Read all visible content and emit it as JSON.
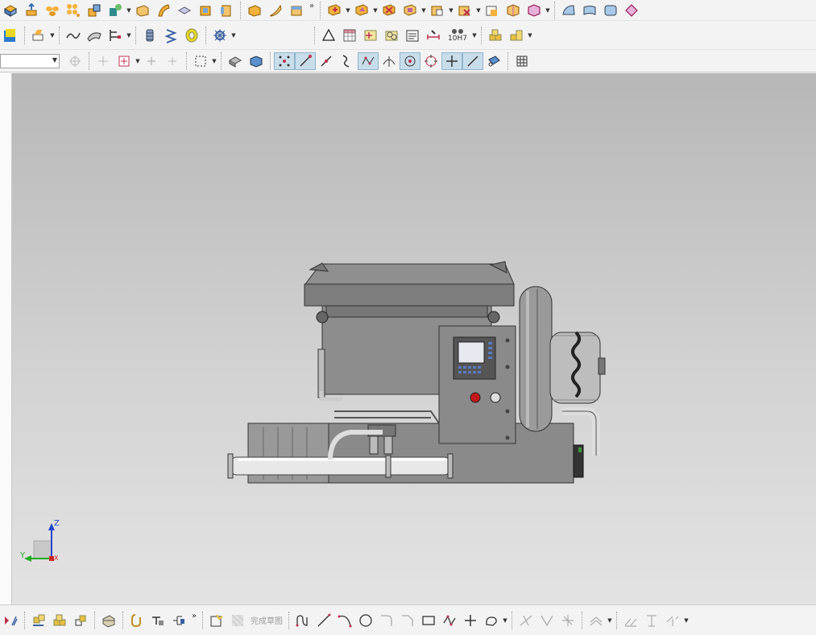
{
  "toolbar_row1": {
    "icons": [
      "block-icon",
      "extrude-icon",
      "pattern-icon",
      "pattern-array-icon",
      "boolean-unite-icon",
      "shape-icon",
      "box-icon",
      "sweep-icon",
      "thicken-icon",
      "shell-icon",
      "cylinder-icon",
      "solid-icon",
      "sheet-icon",
      "block2-icon",
      "unite-icon",
      "subtract-icon",
      "intersect-icon",
      "offset-face-icon",
      "replace-face-icon",
      "delete-face-icon",
      "move-face-icon",
      "surface-icon",
      "surface-grid-icon",
      "surface-patch-icon",
      "trim-icon"
    ],
    "overflow_label": "»"
  },
  "toolbar_row2": {
    "icons": [
      "color-face-icon",
      "text-label-icon",
      "curve-icon",
      "ribbon-icon",
      "section-icon",
      "spring-icon",
      "helix-icon",
      "washer-icon",
      "gear-icon",
      "triangle-icon",
      "table-icon",
      "grid-point-icon",
      "view-icon",
      "note-icon",
      "dimension-icon",
      "fit-label-icon",
      "assembly-icon",
      "component-icon"
    ],
    "fit_label": "10H7"
  },
  "toolbar_row3": {
    "selection_filter_value": "",
    "icons": [
      "filter-icon",
      "snap-icon",
      "select-icon",
      "plus-select-icon",
      "rect-select-icon",
      "view-shaded-icon",
      "view-solid-icon",
      "snap-points-icon",
      "snap-end-icon",
      "snap-mid-icon",
      "snap-curve-icon",
      "snap-control-icon",
      "snap-intersect-icon",
      "snap-center-icon",
      "snap-quadrant-icon",
      "snap-on-icon",
      "snap-line-icon",
      "snap-face-icon",
      "grid-icon"
    ]
  },
  "triad": {
    "z_label": "Z",
    "y_label": "Y",
    "x_label": "X"
  },
  "bottom_toolbar": {
    "finish_sketch_label": "完成草图",
    "icons": [
      "constraint-icon",
      "dimension-icon",
      "assembly-icon",
      "component-icon",
      "part-icon",
      "attach-icon",
      "tool-icon",
      "arrange-icon",
      "sketch-icon",
      "finish-sketch-icon",
      "profile-icon",
      "line-icon",
      "arc-icon",
      "circle-icon",
      "fillet-icon",
      "chamfer-icon",
      "rectangle-icon",
      "polygon-icon",
      "point-icon",
      "curve-icon",
      "trim-icon",
      "extend-icon",
      "corner-icon",
      "offset-icon",
      "mirror-icon",
      "pattern-icon",
      "dim-icon"
    ],
    "overflow_label": "»"
  },
  "colors": {
    "viewport_top": "#b7b7b7",
    "viewport_bottom": "#e3e3e3",
    "model_body": "#8a8a8a",
    "axis_z": "#2244cc",
    "axis_y": "#22aa22",
    "axis_x": "#cc2222"
  }
}
